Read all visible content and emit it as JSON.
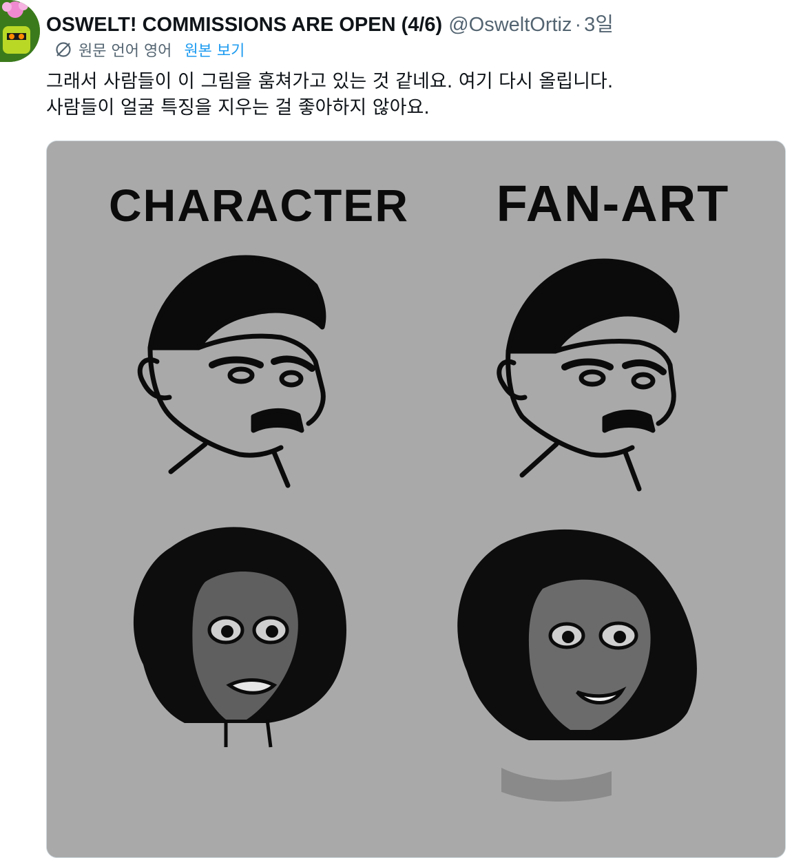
{
  "tweet": {
    "display_name": "OSWELT! COMMISSIONS ARE OPEN (4/6)",
    "handle": "@OsweltOrtiz",
    "separator": "·",
    "time": "3일",
    "translation_label": "원문 언어 영어",
    "show_original": "원본 보기",
    "text_lines": [
      "그래서 사람들이 이 그림을 훔쳐가고 있는 것 같네요. 여기 다시 올립니다.",
      "사람들이 얼굴 특징을 지우는 걸 좋아하지 않아요."
    ]
  },
  "image": {
    "heading_left": "CHARACTER",
    "heading_right": "FAN-ART",
    "background": "#a9a9a9"
  },
  "icons": {
    "avatar": "cartoon-avatar",
    "translate": "translate-icon"
  },
  "colors": {
    "link": "#1d9bf0",
    "secondary_text": "#536471",
    "primary_text": "#0f1419"
  }
}
